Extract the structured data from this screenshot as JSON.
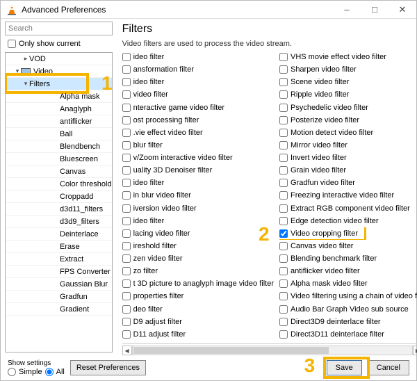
{
  "window": {
    "title": "Advanced Preferences"
  },
  "search": {
    "placeholder": "Search"
  },
  "only_show_current": {
    "label": "Only show current"
  },
  "tree": {
    "vod": "VOD",
    "video": "Video",
    "filters": "Filters",
    "items": [
      "Alpha mask",
      "Anaglyph",
      "antiflicker",
      "Ball",
      "Blendbench",
      "Bluescreen",
      "Canvas",
      "Color threshold",
      "Croppadd",
      "d3d11_filters",
      "d3d9_filters",
      "Deinterlace",
      "Erase",
      "Extract",
      "FPS Converter",
      "Gaussian Blur",
      "Gradfun",
      "Gradient"
    ]
  },
  "right": {
    "heading": "Filters",
    "desc": "Video filters are used to process the video stream.",
    "left": [
      "ideo filter",
      "ansformation filter",
      "ideo filter",
      "video filter",
      "nteractive game video filter",
      "ost processing filter",
      ".vie effect video filter",
      "blur filter",
      "v/Zoom interactive video filter",
      "uality 3D Denoiser filter",
      "ideo filter",
      "in blur video filter",
      "iversion video filter",
      "ideo filter",
      "lacing video filter",
      "ireshold filter",
      "zen video filter",
      "zo filter",
      "t 3D picture to anaglyph image video filter",
      "properties filter",
      "deo filter",
      "D9 adjust filter",
      "D11 adjust filter"
    ],
    "right_items": [
      {
        "label": "VHS movie effect video filter",
        "checked": false
      },
      {
        "label": "Sharpen video filter",
        "checked": false
      },
      {
        "label": "Scene video filter",
        "checked": false
      },
      {
        "label": "Ripple video filter",
        "checked": false
      },
      {
        "label": "Psychedelic video filter",
        "checked": false
      },
      {
        "label": "Posterize video filter",
        "checked": false
      },
      {
        "label": "Motion detect video filter",
        "checked": false
      },
      {
        "label": "Mirror video filter",
        "checked": false
      },
      {
        "label": "Invert video filter",
        "checked": false
      },
      {
        "label": "Grain video filter",
        "checked": false
      },
      {
        "label": "Gradfun video filter",
        "checked": false
      },
      {
        "label": "Freezing interactive video filter",
        "checked": false
      },
      {
        "label": "Extract RGB component video filter",
        "checked": false
      },
      {
        "label": "Edge detection video filter",
        "checked": false
      },
      {
        "label": "Video cropping filter",
        "checked": true
      },
      {
        "label": "Canvas video filter",
        "checked": false
      },
      {
        "label": "Blending benchmark filter",
        "checked": false
      },
      {
        "label": "antiflicker video filter",
        "checked": false
      },
      {
        "label": "Alpha mask video filter",
        "checked": false
      },
      {
        "label": "Video filtering using a chain of video filt",
        "checked": false
      },
      {
        "label": "Audio Bar Graph Video sub source",
        "checked": false
      },
      {
        "label": "Direct3D9 deinterlace filter",
        "checked": false
      },
      {
        "label": "Direct3D11 deinterlace filter",
        "checked": false
      }
    ]
  },
  "bottom": {
    "show_settings": "Show settings",
    "simple": "Simple",
    "all": "All",
    "reset": "Reset Preferences",
    "save": "Save",
    "cancel": "Cancel"
  },
  "annotations": {
    "n1": "1",
    "n2": "2",
    "n3": "3"
  }
}
